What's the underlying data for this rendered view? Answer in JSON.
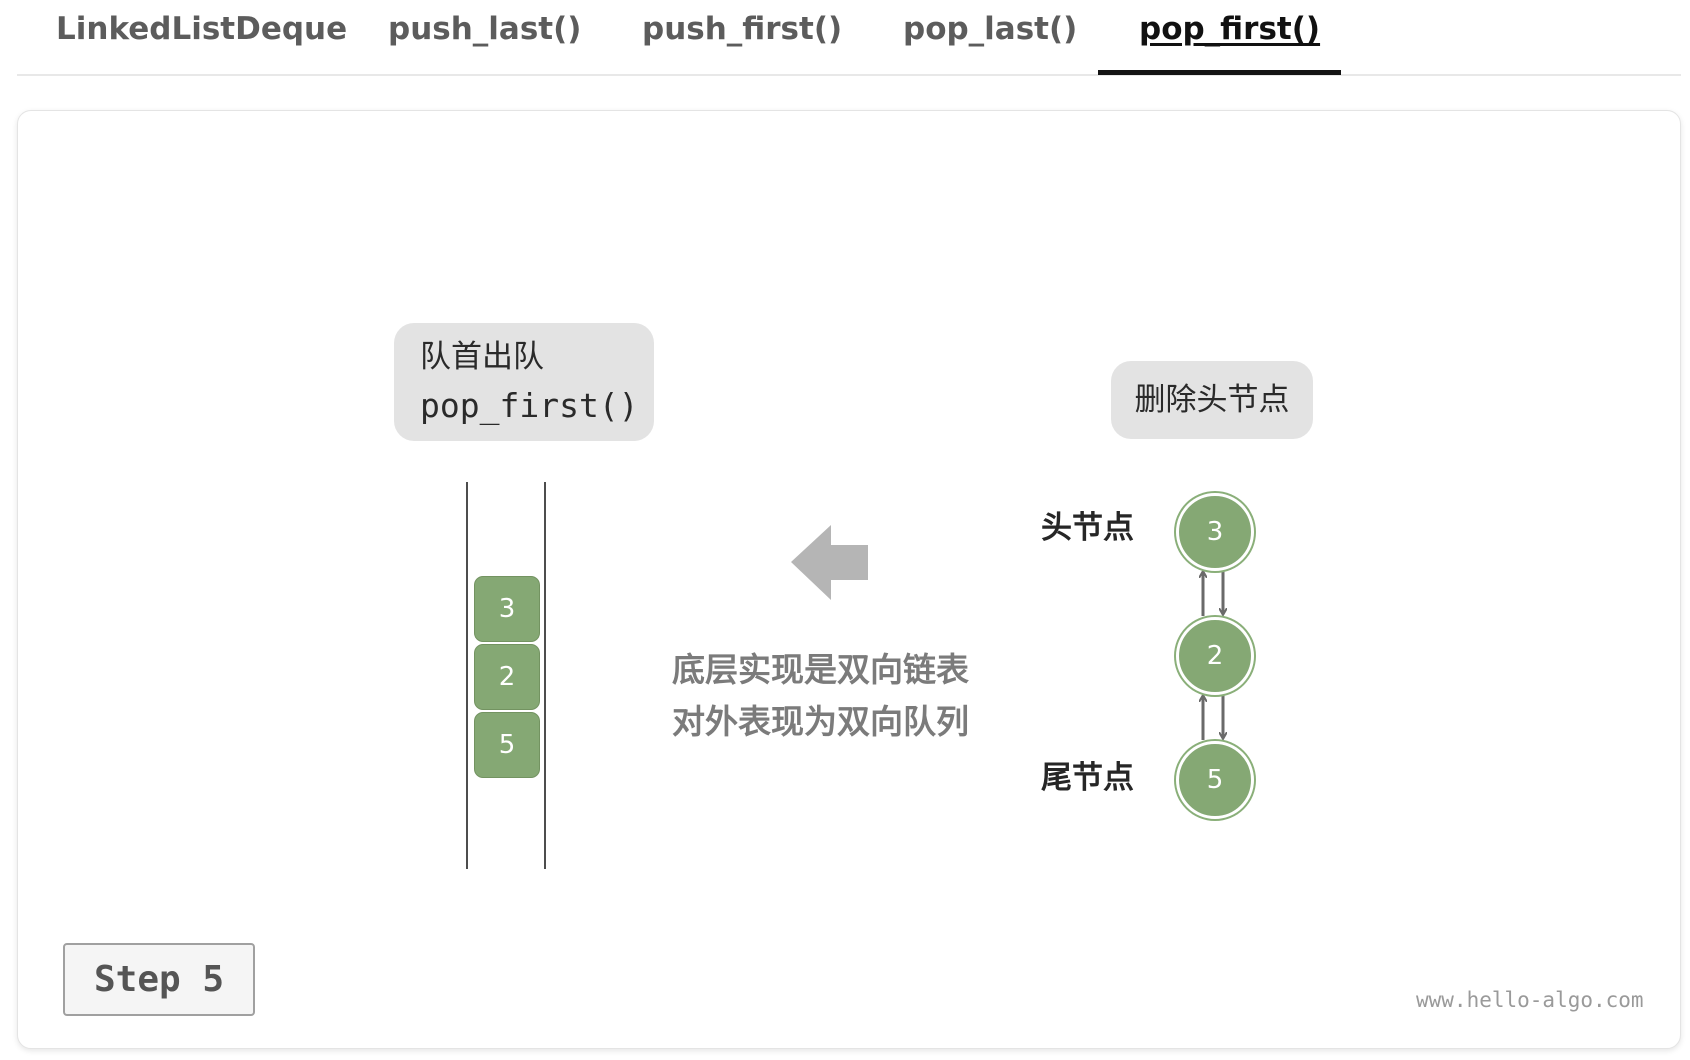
{
  "tabs": [
    {
      "label": "LinkedListDeque",
      "active": false
    },
    {
      "label": "push_last()",
      "active": false
    },
    {
      "label": "push_first()",
      "active": false
    },
    {
      "label": "pop_last()",
      "active": false
    },
    {
      "label": "pop_first()",
      "active": true
    }
  ],
  "diagram": {
    "operation_box": {
      "title": "队首出队",
      "method": "pop_first()"
    },
    "queue_cells": [
      "3",
      "2",
      "5"
    ],
    "description": [
      "底层实现是双向链表",
      "对外表现为双向队列"
    ],
    "delete_box": "删除头节点",
    "linked_list": {
      "nodes": [
        "3",
        "2",
        "5"
      ],
      "head_label": "头节点",
      "tail_label": "尾节点"
    },
    "step": "Step 5",
    "watermark": "www.hello-algo.com"
  },
  "colors": {
    "node_fill": "#85a874",
    "box_fill": "#e3e3e3",
    "arrow_fill": "#b5b5b5",
    "active_tab": "#141414"
  }
}
